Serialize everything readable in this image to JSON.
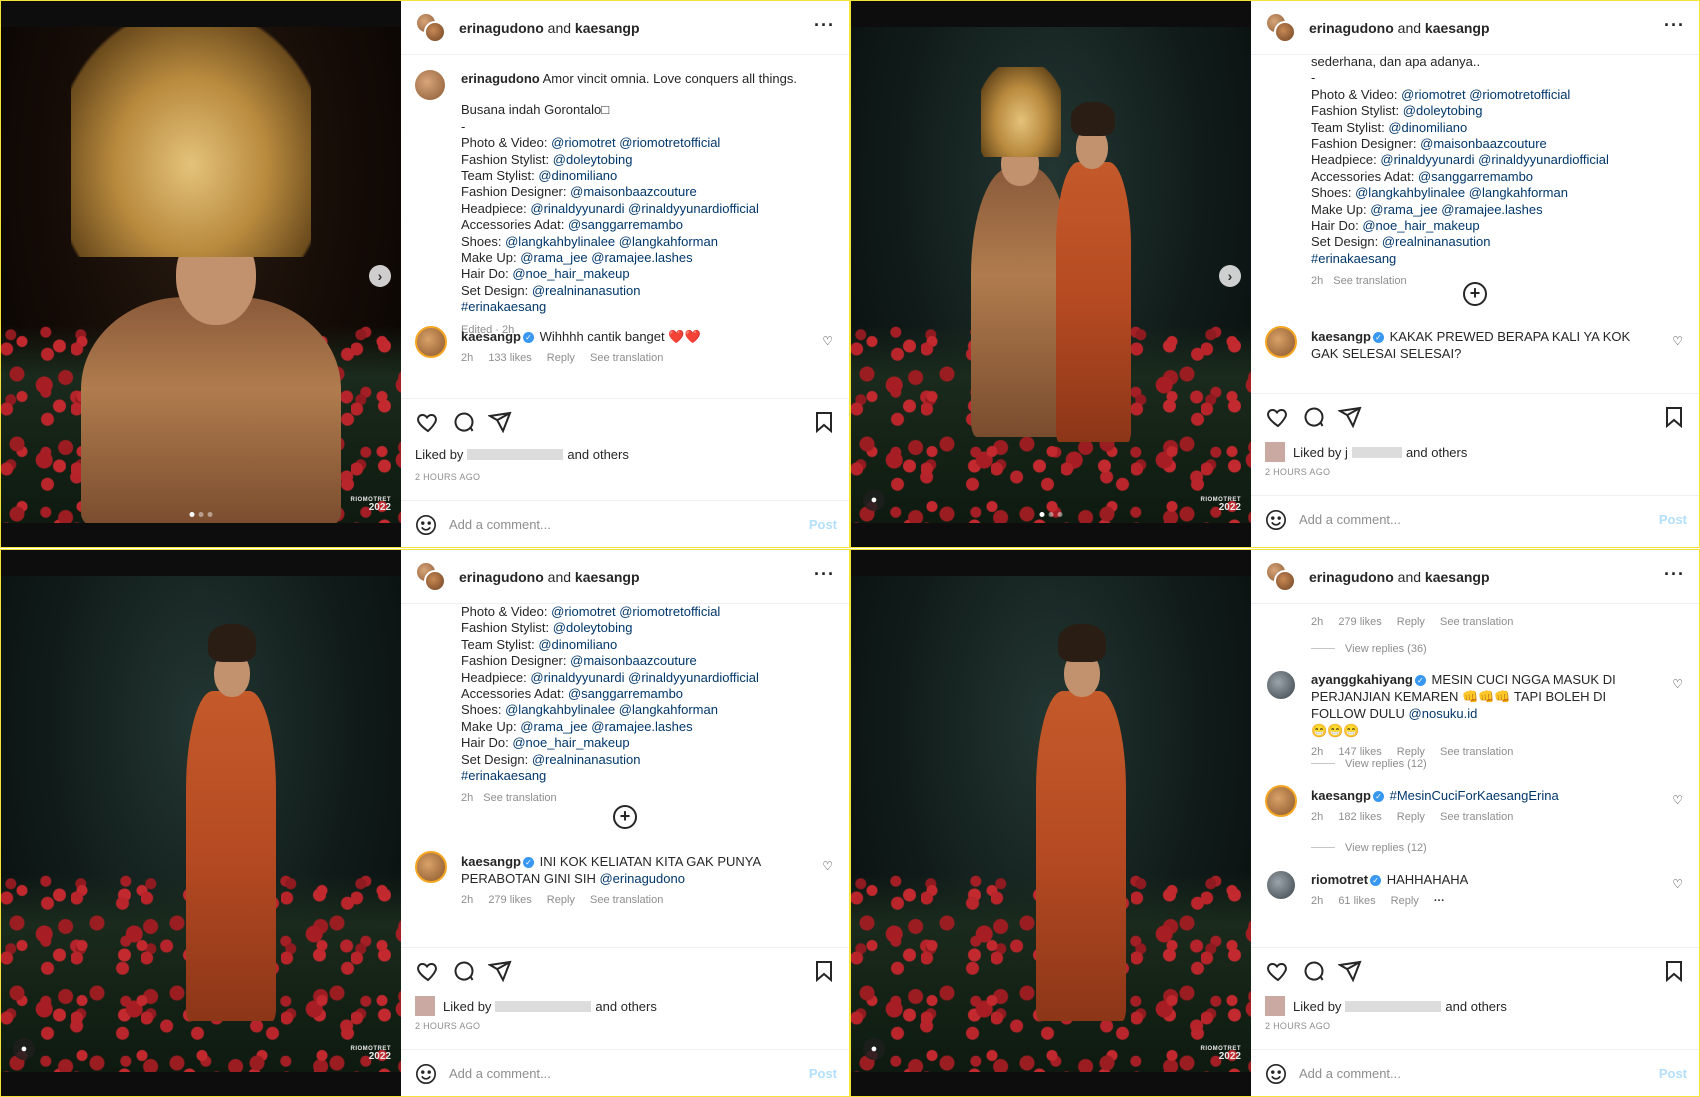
{
  "header": {
    "user1": "erinagudono",
    "and_text": "and",
    "user2": "kaesangp",
    "more": "···"
  },
  "watermark": {
    "brand": "RIOMOTRET",
    "year": "2022"
  },
  "caption": {
    "author": "erinagudono",
    "text": "Amor vincit omnia. Love conquers all things.",
    "line2": "Busana indah Gorontalo□",
    "dash": "-",
    "line_intro": "sederhana, dan apa adanya..",
    "credits": [
      {
        "label": "Photo & Video:",
        "value": "@riomotret @riomotretofficial"
      },
      {
        "label": "Fashion Stylist:",
        "value": "@doleytobing"
      },
      {
        "label": "Team Stylist:",
        "value": "@dinomiliano"
      },
      {
        "label": "Fashion Designer:",
        "value": "@maisonbaazcouture"
      },
      {
        "label": "Headpiece:",
        "value": "@rinaldyyunardi @rinaldyyunardiofficial"
      },
      {
        "label": "Accessories Adat:",
        "value": "@sanggarremambo"
      },
      {
        "label": "Shoes:",
        "value": "@langkahbylinalee @langkahforman"
      },
      {
        "label": "Make Up:",
        "value": "@rama_jee @ramajee.lashes"
      },
      {
        "label": "Hair Do:",
        "value": "@noe_hair_makeup"
      },
      {
        "label": "Set Design:",
        "value": "@realninanasution"
      }
    ],
    "hashtag": "#erinakaesang",
    "edited": "Edited · 2h",
    "time": "2h",
    "see_translation": "See translation"
  },
  "comments": {
    "p1": {
      "user": "kaesangp",
      "text": "Wihhhh cantik banget",
      "emoji": "❤️❤️",
      "time": "2h",
      "likes": "133 likes",
      "reply": "Reply",
      "translate": "See translation"
    },
    "p2": {
      "user": "kaesangp",
      "text": "KAKAK PREWED BERAPA KALI YA KOK GAK SELESAI SELESAI?"
    },
    "p3": {
      "user": "kaesangp",
      "text": "INI KOK KELIATAN KITA GAK PUNYA PERABOTAN GINI SIH",
      "mention": "@erinagudono",
      "time": "2h",
      "likes": "279 likes",
      "reply": "Reply",
      "translate": "See translation"
    },
    "p4": {
      "top_meta": {
        "time": "2h",
        "likes": "279 likes",
        "reply": "Reply",
        "translate": "See translation"
      },
      "view1": "View replies (36)",
      "c1": {
        "user": "ayanggkahiyang",
        "text": "MESIN CUCI NGGA MASUK DI PERJANJIAN KEMAREN 👊👊👊 TAPI BOLEH DI FOLLOW DULU",
        "mention": "@nosuku.id",
        "extra": "😁😁😁",
        "time": "2h",
        "likes": "147 likes",
        "reply": "Reply",
        "translate": "See translation"
      },
      "view2": "View replies (12)",
      "c2": {
        "user": "kaesangp",
        "text": "#MesinCuciForKaesangErina",
        "time": "2h",
        "likes": "182 likes",
        "reply": "Reply",
        "translate": "See translation"
      },
      "view3": "View replies (12)",
      "c3": {
        "user": "riomotret",
        "text": "HAHHAHAHA",
        "time": "2h",
        "likes": "61 likes",
        "reply": "Reply",
        "dots": "···"
      }
    }
  },
  "footer": {
    "liked_by": "Liked by",
    "liked_initial_j": "j",
    "and_others": "and others",
    "ago": "2 HOURS AGO",
    "add_comment": "Add a comment...",
    "post": "Post"
  },
  "colors": {
    "link": "#00376b",
    "verified": "#3897f0",
    "border": "#f3e33a"
  }
}
